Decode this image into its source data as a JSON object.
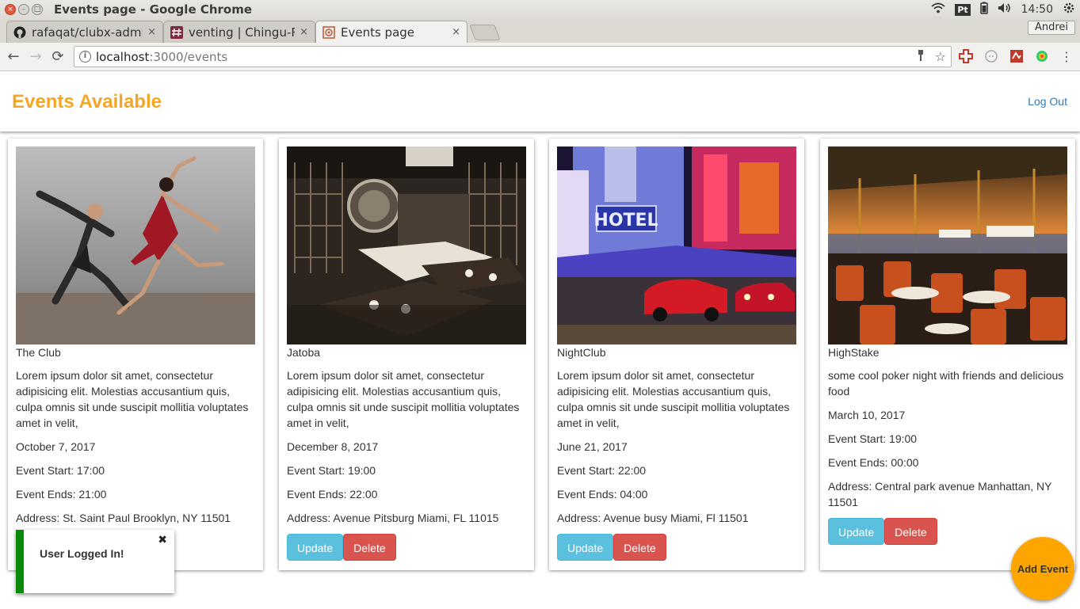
{
  "window": {
    "title": "Events page - Google Chrome",
    "time": "14:50",
    "tray_pt": "Pt"
  },
  "tabs": [
    {
      "label": "rafaqat/clubx-admi",
      "close": "×"
    },
    {
      "label": "venting | Chingu-Re",
      "close": "×"
    },
    {
      "label": "Events page",
      "close": "×"
    }
  ],
  "profile_name": "Andrei",
  "address": {
    "host": "localhost",
    "path": ":3000/events"
  },
  "navbar": {
    "brand": "Events Available",
    "logout": "Log Out"
  },
  "events": [
    {
      "name": "The Club",
      "description": "Lorem ipsum dolor sit amet, consectetur adipisicing elit. Molestias accusantium quis, culpa omnis sit unde suscipit mollitia voluptates amet in velit,",
      "date": "October 7, 2017",
      "start": "Event Start: 17:00",
      "end": "Event Ends: 21:00",
      "address": "Address: St. Saint Paul Brooklyn, NY 11501"
    },
    {
      "name": "Jatoba",
      "description": "Lorem ipsum dolor sit amet, consectetur adipisicing elit. Molestias accusantium quis, culpa omnis sit unde suscipit mollitia voluptates amet in velit,",
      "date": "December 8, 2017",
      "start": "Event Start: 19:00",
      "end": "Event Ends: 22:00",
      "address": "Address: Avenue Pitsburg Miami, FL 11015"
    },
    {
      "name": "NightClub",
      "description": "Lorem ipsum dolor sit amet, consectetur adipisicing elit. Molestias accusantium quis, culpa omnis sit unde suscipit mollitia voluptates amet in velit,",
      "date": "June 21, 2017",
      "start": "Event Start: 22:00",
      "end": "Event Ends: 04:00",
      "address": "Address: Avenue busy Miami, Fl 11501"
    },
    {
      "name": "HighStake",
      "description": "some cool poker night with friends and delicious food",
      "date": "March 10, 2017",
      "start": "Event Start: 19:00",
      "end": "Event Ends: 00:00",
      "address": "Address: Central park avenue Manhattan, NY 11501"
    }
  ],
  "buttons": {
    "update": "Update",
    "delete": "Delete"
  },
  "toast": {
    "message": "User Logged In!",
    "close": "✖"
  },
  "fab": "Add Event",
  "colors": {
    "brand": "#f5a623",
    "link": "#337ab7",
    "update": "#5bc0de",
    "delete": "#d9534f",
    "toast_accent": "#0a8a0a",
    "fab": "#ffa500"
  }
}
